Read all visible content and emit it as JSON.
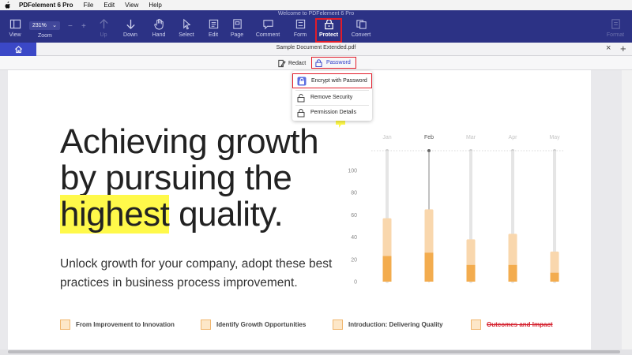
{
  "menubar": {
    "app_name": "PDFelement 6 Pro",
    "items": [
      "File",
      "Edit",
      "View",
      "Help"
    ]
  },
  "window": {
    "title": "Welcome to PDFelement 6 Pro"
  },
  "toolbar": {
    "zoom_value": "231%",
    "zoom_label": "Zoom",
    "zoom_minus": "−",
    "zoom_plus": "+",
    "buttons": [
      {
        "label": "View",
        "icon": "sidebar-icon"
      },
      {
        "label": "Up",
        "icon": "arrow-up-icon",
        "disabled": true
      },
      {
        "label": "Down",
        "icon": "arrow-down-icon"
      },
      {
        "label": "Hand",
        "icon": "hand-icon"
      },
      {
        "label": "Select",
        "icon": "cursor-icon"
      },
      {
        "label": "Edit",
        "icon": "edit-icon"
      },
      {
        "label": "Page",
        "icon": "page-icon"
      },
      {
        "label": "Comment",
        "icon": "comment-icon"
      },
      {
        "label": "Form",
        "icon": "form-icon"
      },
      {
        "label": "Protect",
        "icon": "lock-icon",
        "active": true
      },
      {
        "label": "Convert",
        "icon": "convert-icon"
      },
      {
        "label": "Format",
        "icon": "format-icon",
        "disabled": true
      }
    ]
  },
  "tabbar": {
    "document_title": "Sample Document Extended.pdf",
    "close_glyph": "×",
    "add_glyph": "+"
  },
  "subtoolbar": {
    "redact_label": "Redact",
    "password_label": "Password"
  },
  "password_menu": {
    "items": [
      "Encrypt with Password",
      "Remove Security",
      "Permission Details"
    ]
  },
  "document": {
    "headline_line1": "Achieving growth",
    "headline_line2": "by pursuing the",
    "headline_highlight": "highest",
    "headline_line3_rest": " quality.",
    "subtext": "Unlock growth for your company, adopt these best practices in business process improvement.",
    "features": [
      {
        "label": "From Improvement to Innovation",
        "strike": false
      },
      {
        "label": "Identify Growth Opportunities",
        "strike": false
      },
      {
        "label": "Introduction: Delivering Quality",
        "strike": false
      },
      {
        "label": "Outcomes and Impact",
        "strike": true
      }
    ]
  },
  "chart_data": {
    "type": "bar",
    "categories": [
      "Jan",
      "Feb",
      "Mar",
      "Apr",
      "May"
    ],
    "highlighted_category": "Feb",
    "y_ticks": [
      100,
      80,
      60,
      40,
      20,
      0
    ],
    "ylim": [
      0,
      100
    ],
    "series": [
      {
        "values": [
          57,
          65,
          38,
          43,
          27
        ],
        "color": "#f9d7ad"
      },
      {
        "values": [
          23,
          26,
          15,
          15,
          8
        ],
        "color": "#f3ac4e"
      }
    ],
    "track_color": "#e5e5e5",
    "grid": false
  },
  "colors": {
    "toolbar_bg": "#2c3285",
    "accent_blue": "#3b48c7",
    "annotation_red": "#e21c2a",
    "highlight_yellow": "#fff94a",
    "bar_light": "#f9d7ad",
    "bar_dark": "#f3ac4e"
  }
}
